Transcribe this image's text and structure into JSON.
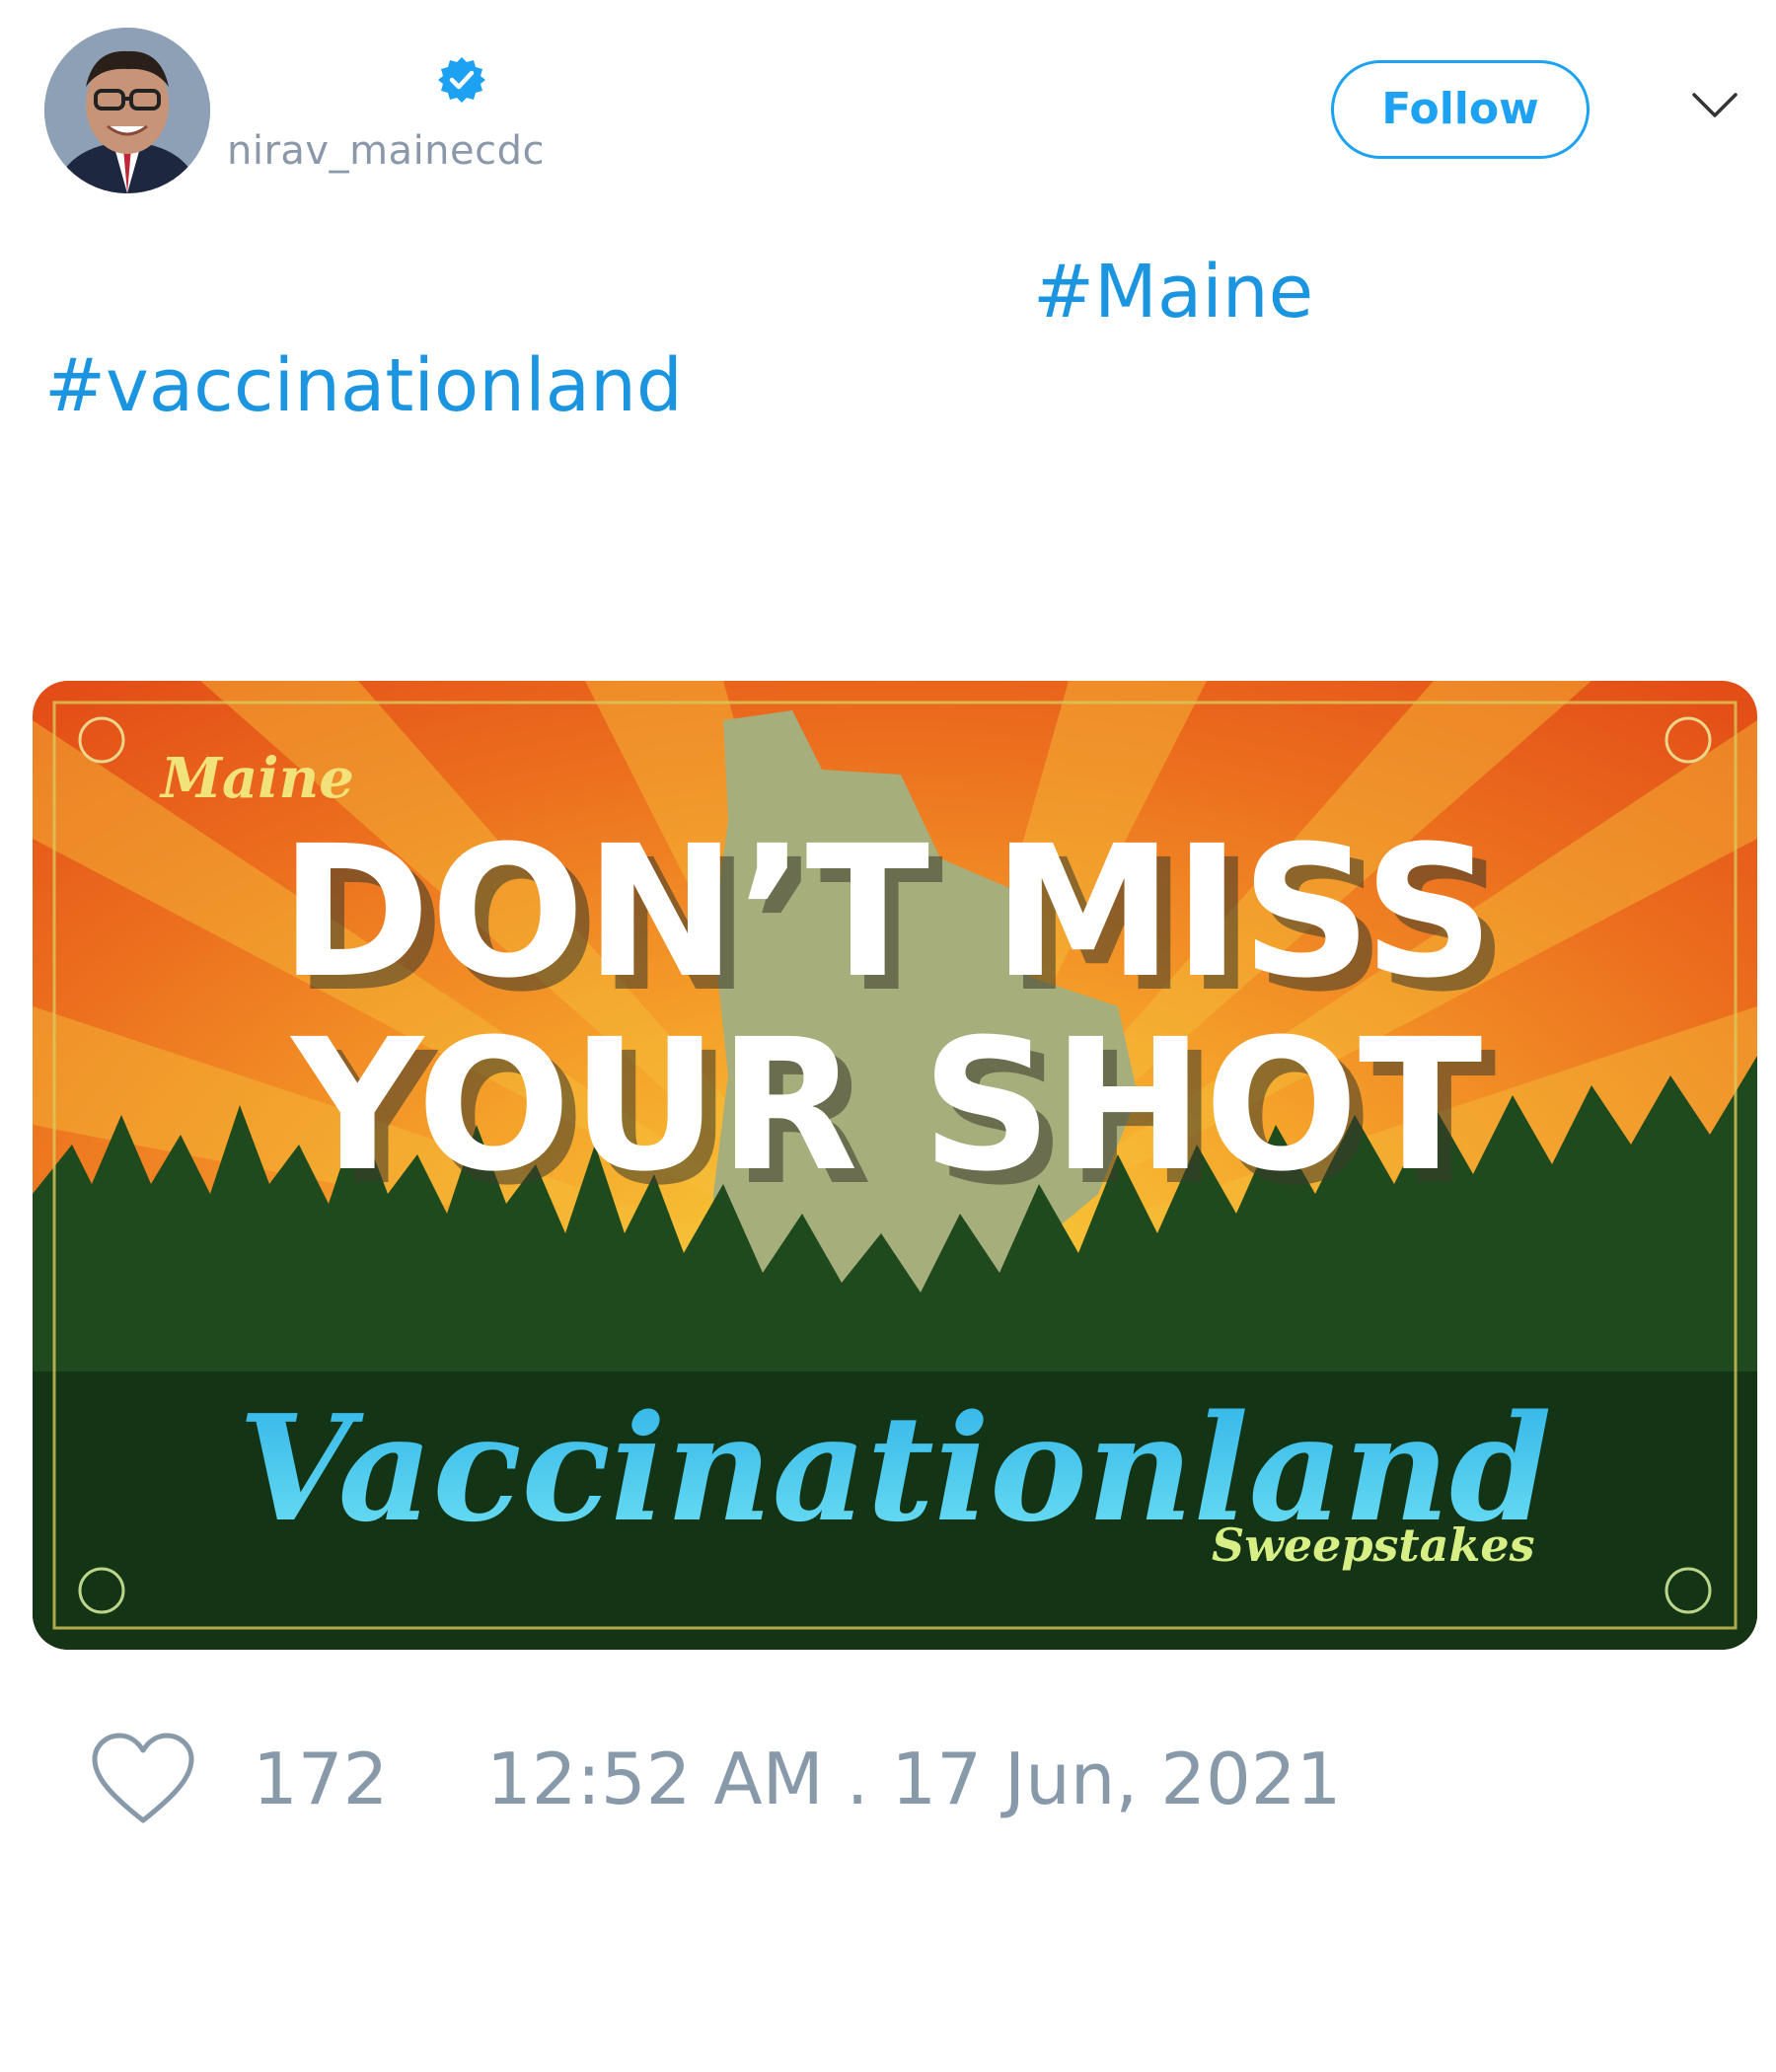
{
  "author": {
    "handle": "nirav_mainecdc",
    "verified": true,
    "avatar_icon": "avatar-photo"
  },
  "header": {
    "follow_label": "Follow",
    "menu_icon": "chevron-down-icon"
  },
  "tweet": {
    "hashtags": [
      "#Maine",
      "#vaccinationland"
    ]
  },
  "media": {
    "small_top": "Maine",
    "headline_line1": "DON’T MISS",
    "headline_line2": "YOUR SHOT",
    "script_word": "Vaccinationland",
    "small_bottom": "Sweepstakes"
  },
  "footer": {
    "likes": "172",
    "timestamp": "12:52 AM . 17 Jun, 2021",
    "like_icon": "heart-icon"
  },
  "colors": {
    "link": "#1b95e0",
    "follow": "#1da1f2",
    "muted": "#8899aa",
    "banner_orange": "#e8551a",
    "banner_green": "#163a1a",
    "script_blue": "#4fc8ec"
  }
}
